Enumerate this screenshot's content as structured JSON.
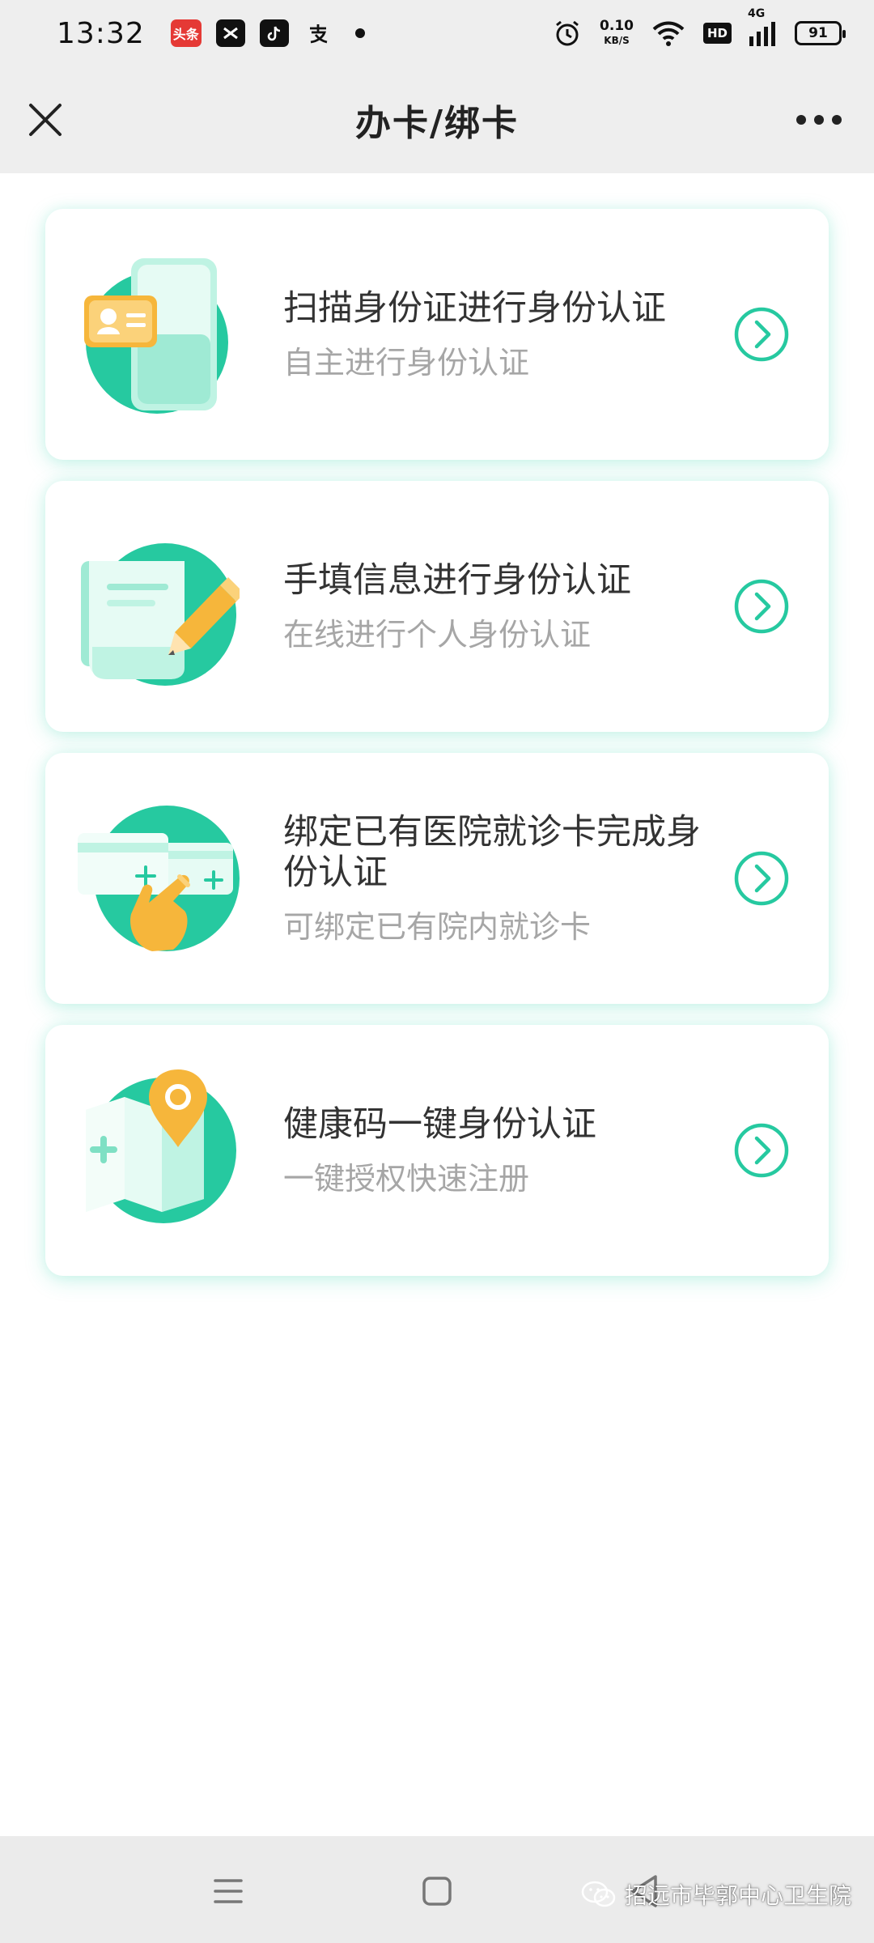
{
  "status_bar": {
    "time": "13:32",
    "apps": [
      "头条",
      "剪映",
      "抖音",
      "支付宝"
    ],
    "net_speed_value": "0.10",
    "net_speed_unit": "KB/S",
    "hd_label": "HD",
    "network_label": "4G",
    "battery_level": "91"
  },
  "nav": {
    "title": "办卡/绑卡"
  },
  "cards": [
    {
      "title": "扫描身份证进行身份认证",
      "subtitle": "自主进行身份认证",
      "icon": "id-card-scan-icon"
    },
    {
      "title": "手填信息进行身份认证",
      "subtitle": "在线进行个人身份认证",
      "icon": "form-fill-icon"
    },
    {
      "title": "绑定已有医院就诊卡完成身份认证",
      "subtitle": "可绑定已有院内就诊卡",
      "icon": "bind-card-icon"
    },
    {
      "title": "健康码一键身份认证",
      "subtitle": "一键授权快速注册",
      "icon": "health-code-map-icon"
    }
  ],
  "watermark": "招远市毕郭中心卫生院",
  "colors": {
    "accent": "#26c9a0",
    "nav_bg": "#eeeeee",
    "subtitle": "#a6a6a6",
    "illustration_orange": "#f6b63b"
  }
}
